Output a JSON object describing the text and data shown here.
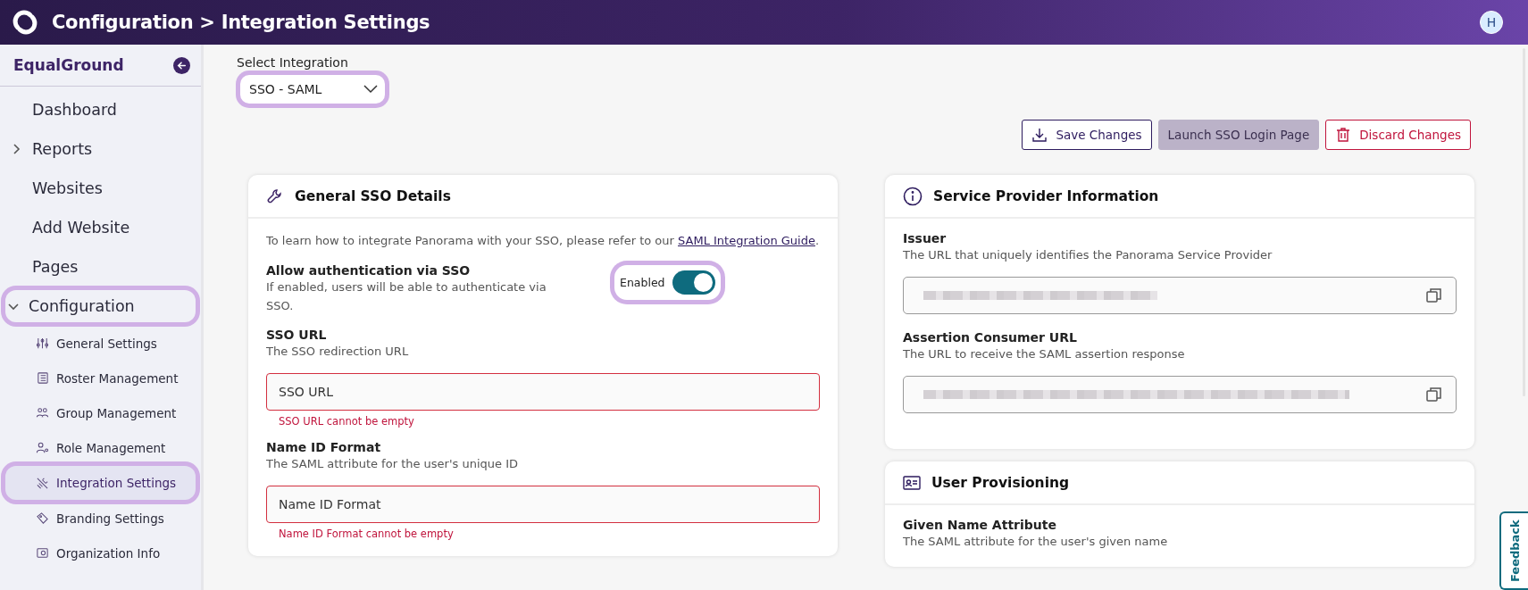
{
  "header": {
    "title": "Configuration > Integration Settings",
    "avatar": "H"
  },
  "sidebar": {
    "brand": "EqualGround",
    "items": [
      {
        "label": "Dashboard",
        "kind": "plain",
        "selected": false,
        "highlighted": false
      },
      {
        "label": "Reports",
        "kind": "group",
        "expanded": false,
        "selected": false,
        "highlighted": false
      },
      {
        "label": "Websites",
        "kind": "plain",
        "selected": false,
        "highlighted": false
      },
      {
        "label": "Add Website",
        "kind": "plain",
        "selected": false,
        "highlighted": false
      },
      {
        "label": "Pages",
        "kind": "plain",
        "selected": false,
        "highlighted": false
      },
      {
        "label": "Configuration",
        "kind": "group",
        "expanded": true,
        "selected": false,
        "highlighted": true,
        "children": [
          {
            "label": "General Settings",
            "selected": false,
            "highlighted": false
          },
          {
            "label": "Roster Management",
            "selected": false,
            "highlighted": false
          },
          {
            "label": "Group Management",
            "selected": false,
            "highlighted": false
          },
          {
            "label": "Role Management",
            "selected": false,
            "highlighted": false
          },
          {
            "label": "Integration Settings",
            "selected": true,
            "highlighted": true
          },
          {
            "label": "Branding Settings",
            "selected": false,
            "highlighted": false
          },
          {
            "label": "Organization Info",
            "selected": false,
            "highlighted": false
          }
        ]
      }
    ]
  },
  "integration": {
    "label": "Select Integration",
    "value": "SSO - SAML",
    "highlighted": true
  },
  "actions": [
    {
      "label": "Save Changes",
      "kind": "save",
      "disabled": false
    },
    {
      "label": "Launch SSO Login Page",
      "kind": "launch",
      "disabled": true
    },
    {
      "label": "Discard Changes",
      "kind": "discard",
      "disabled": false
    }
  ],
  "general_card": {
    "title": "General SSO Details",
    "intro": "To learn how to integrate Panorama with your SSO, please refer to our ",
    "link": "SAML Integration Guide",
    "intro_end": ".",
    "toggle": {
      "label": "Allow authentication via SSO",
      "description": "If enabled, users will be able to authenticate via SSO.",
      "state_label": "Enabled",
      "on": true,
      "highlighted": true
    },
    "fields": [
      {
        "label": "SSO URL",
        "description": "The SSO redirection URL",
        "placeholder": "SSO URL",
        "error": "SSO URL cannot be empty"
      },
      {
        "label": "Name ID Format",
        "description": "The SAML attribute for the user's unique ID",
        "placeholder": "Name ID Format",
        "error": "Name ID Format cannot be empty"
      }
    ]
  },
  "sp_card": {
    "title": "Service Provider Information",
    "fields": [
      {
        "label": "Issuer",
        "description": "The URL that uniquely identifies the Panorama Service Provider"
      },
      {
        "label": "Assertion Consumer URL",
        "description": "The URL to receive the SAML assertion response"
      }
    ]
  },
  "provisioning_card": {
    "title": "User Provisioning",
    "fields": [
      {
        "label": "Given Name Attribute",
        "description": "The SAML attribute for the user's given name"
      }
    ]
  },
  "feedback": "Feedback"
}
